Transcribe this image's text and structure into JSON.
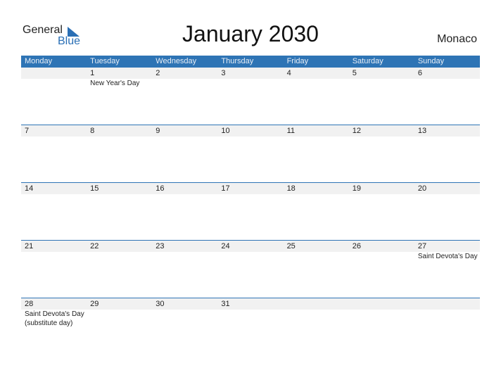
{
  "logo": {
    "general": "General",
    "blue": "Blue",
    "icon": "triangle-flag-icon"
  },
  "title": "January 2030",
  "country": "Monaco",
  "colors": {
    "header_bg": "#2e74b5",
    "band_bg": "#f1f1f1",
    "brand_blue": "#2a6fb5"
  },
  "weekdays": [
    "Monday",
    "Tuesday",
    "Wednesday",
    "Thursday",
    "Friday",
    "Saturday",
    "Sunday"
  ],
  "weeks": [
    [
      {
        "day": "",
        "event": ""
      },
      {
        "day": "1",
        "event": "New Year's Day"
      },
      {
        "day": "2",
        "event": ""
      },
      {
        "day": "3",
        "event": ""
      },
      {
        "day": "4",
        "event": ""
      },
      {
        "day": "5",
        "event": ""
      },
      {
        "day": "6",
        "event": ""
      }
    ],
    [
      {
        "day": "7",
        "event": ""
      },
      {
        "day": "8",
        "event": ""
      },
      {
        "day": "9",
        "event": ""
      },
      {
        "day": "10",
        "event": ""
      },
      {
        "day": "11",
        "event": ""
      },
      {
        "day": "12",
        "event": ""
      },
      {
        "day": "13",
        "event": ""
      }
    ],
    [
      {
        "day": "14",
        "event": ""
      },
      {
        "day": "15",
        "event": ""
      },
      {
        "day": "16",
        "event": ""
      },
      {
        "day": "17",
        "event": ""
      },
      {
        "day": "18",
        "event": ""
      },
      {
        "day": "19",
        "event": ""
      },
      {
        "day": "20",
        "event": ""
      }
    ],
    [
      {
        "day": "21",
        "event": ""
      },
      {
        "day": "22",
        "event": ""
      },
      {
        "day": "23",
        "event": ""
      },
      {
        "day": "24",
        "event": ""
      },
      {
        "day": "25",
        "event": ""
      },
      {
        "day": "26",
        "event": ""
      },
      {
        "day": "27",
        "event": "Saint Devota's Day"
      }
    ],
    [
      {
        "day": "28",
        "event": "Saint Devota's Day (substitute day)"
      },
      {
        "day": "29",
        "event": ""
      },
      {
        "day": "30",
        "event": ""
      },
      {
        "day": "31",
        "event": ""
      },
      {
        "day": "",
        "event": ""
      },
      {
        "day": "",
        "event": ""
      },
      {
        "day": "",
        "event": ""
      }
    ]
  ]
}
